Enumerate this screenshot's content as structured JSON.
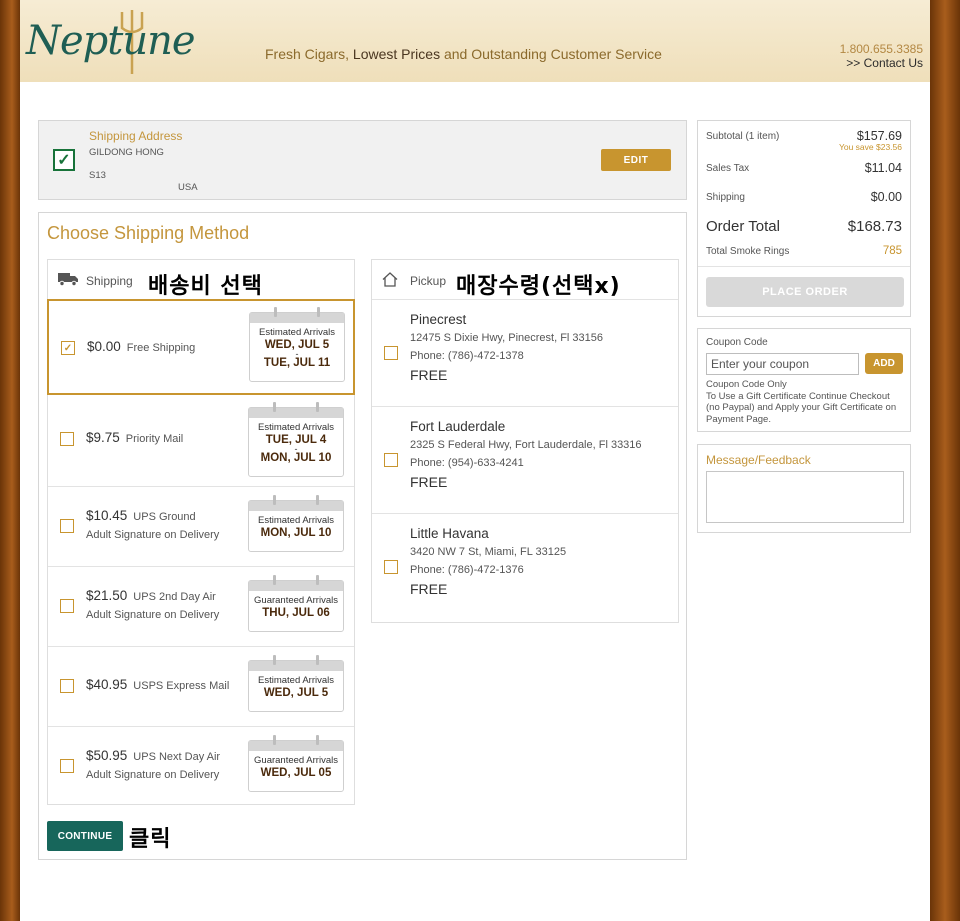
{
  "header": {
    "logo_text": "Neptune",
    "tagline_a": "Fresh Cigars, ",
    "tagline_b": "Lowest Prices",
    "tagline_c": " and Outstanding Customer Service",
    "phone": "1.800.655.3385",
    "contact_link": ">> Contact Us"
  },
  "address": {
    "title": "Shipping Address",
    "name": "GILDONG HONG",
    "line2": "S13",
    "country": "USA",
    "edit_label": "EDIT"
  },
  "method": {
    "title": "Choose Shipping Method",
    "shipping_label": "Shipping",
    "pickup_label": "Pickup",
    "annot_shipping": "배송비 선택",
    "annot_pickup": "매장수령(선택x)",
    "annot_continue": "클릭",
    "continue_label": "CONTINUE"
  },
  "shipping_options": [
    {
      "price": "$0.00",
      "carrier": "Free Shipping",
      "sig": "",
      "arrival_label": "Estimated Arrivals",
      "date1": "WED, JUL 5",
      "dash": "-",
      "date2": "TUE, JUL 11",
      "checked": true
    },
    {
      "price": "$9.75",
      "carrier": "Priority Mail",
      "sig": "",
      "arrival_label": "Estimated Arrivals",
      "date1": "TUE, JUL 4",
      "dash": "-",
      "date2": "MON, JUL 10",
      "checked": false
    },
    {
      "price": "$10.45",
      "carrier": "UPS Ground",
      "sig": "Adult Signature on Delivery",
      "arrival_label": "Estimated Arrivals",
      "date1": "MON, JUL 10",
      "checked": false
    },
    {
      "price": "$21.50",
      "carrier": "UPS 2nd Day Air",
      "sig": "Adult Signature on Delivery",
      "arrival_label": "Guaranteed Arrivals",
      "date1": "THU, JUL 06",
      "checked": false
    },
    {
      "price": "$40.95",
      "carrier": "USPS Express Mail",
      "sig": "",
      "arrival_label": "Estimated Arrivals",
      "date1": "WED, JUL 5",
      "checked": false
    },
    {
      "price": "$50.95",
      "carrier": "UPS Next Day Air",
      "sig": "Adult Signature on Delivery",
      "arrival_label": "Guaranteed Arrivals",
      "date1": "WED, JUL 05",
      "checked": false
    }
  ],
  "pickup_options": [
    {
      "name": "Pinecrest",
      "address": "12475 S Dixie Hwy, Pinecrest, Fl 33156",
      "phone": "Phone: (786)-472-1378",
      "price": "FREE"
    },
    {
      "name": "Fort Lauderdale",
      "address": "2325 S Federal Hwy, Fort Lauderdale, Fl 33316",
      "phone": "Phone: (954)-633-4241",
      "price": "FREE"
    },
    {
      "name": "Little Havana",
      "address": "3420 NW 7 St, Miami, FL 33125",
      "phone": "Phone: (786)-472-1376",
      "price": "FREE"
    }
  ],
  "summary": {
    "subtotal_label": "Subtotal (1 item)",
    "subtotal": "$157.69",
    "save": "You save $23.56",
    "tax_label": "Sales Tax",
    "tax": "$11.04",
    "shipping_label": "Shipping",
    "shipping": "$0.00",
    "total_label": "Order Total",
    "total": "$168.73",
    "rings_label": "Total Smoke Rings",
    "rings": "785",
    "place_label": "PLACE ORDER"
  },
  "coupon": {
    "label": "Coupon Code",
    "placeholder": "Enter your coupon",
    "add_label": "ADD",
    "note1": "Coupon Code Only",
    "note2": "To Use a Gift Certificate Continue Checkout (no Paypal) and Apply your Gift Certificate on Payment Page."
  },
  "feedback": {
    "label": "Message/Feedback"
  },
  "colors": {
    "gold": "#c8952f",
    "teal": "#17665b",
    "green_check": "#18733a"
  }
}
